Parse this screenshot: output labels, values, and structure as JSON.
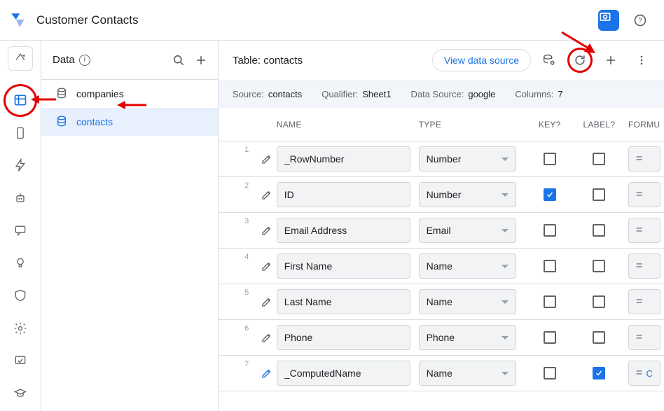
{
  "app_title": "Customer Contacts",
  "sidebar": {
    "title": "Data",
    "items": [
      {
        "label": "companies",
        "selected": false
      },
      {
        "label": "contacts",
        "selected": true
      }
    ]
  },
  "table_header": {
    "prefix": "Table: ",
    "name": "contacts",
    "view_source_label": "View data source"
  },
  "source_bar": {
    "source_label": "Source:",
    "source_value": "contacts",
    "qualifier_label": "Qualifier:",
    "qualifier_value": "Sheet1",
    "datasource_label": "Data Source:",
    "datasource_value": "google",
    "columns_label": "Columns:",
    "columns_value": "7"
  },
  "columns_header": {
    "name": "NAME",
    "type": "TYPE",
    "key": "KEY?",
    "label": "LABEL?",
    "formula": "FORMU"
  },
  "rows": [
    {
      "n": "1",
      "name": "_RowNumber",
      "type": "Number",
      "key": false,
      "label": false,
      "formula": "=",
      "extra": "",
      "blue_pencil": false
    },
    {
      "n": "2",
      "name": "ID",
      "type": "Number",
      "key": true,
      "label": false,
      "formula": "=",
      "extra": "",
      "blue_pencil": false
    },
    {
      "n": "3",
      "name": "Email Address",
      "type": "Email",
      "key": false,
      "label": false,
      "formula": "=",
      "extra": "",
      "blue_pencil": false
    },
    {
      "n": "4",
      "name": "First Name",
      "type": "Name",
      "key": false,
      "label": false,
      "formula": "=",
      "extra": "",
      "blue_pencil": false
    },
    {
      "n": "5",
      "name": "Last Name",
      "type": "Name",
      "key": false,
      "label": false,
      "formula": "=",
      "extra": "",
      "blue_pencil": false
    },
    {
      "n": "6",
      "name": "Phone",
      "type": "Phone",
      "key": false,
      "label": false,
      "formula": "=",
      "extra": "",
      "blue_pencil": false
    },
    {
      "n": "7",
      "name": "_ComputedName",
      "type": "Name",
      "key": false,
      "label": true,
      "formula": "=",
      "extra": "C",
      "blue_pencil": true
    }
  ]
}
